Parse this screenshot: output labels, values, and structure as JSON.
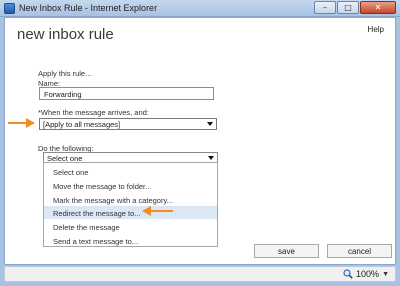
{
  "window": {
    "title": "New Inbox Rule - Internet Explorer",
    "minimize_icon": "minimize-icon",
    "maximize_icon": "maximize-icon",
    "close_icon": "close-icon",
    "minimize_glyph": "–",
    "maximize_glyph": "□",
    "close_glyph": "✕"
  },
  "page": {
    "heading": "new inbox rule",
    "help": "Help"
  },
  "form": {
    "apply_label": "Apply this rule...",
    "name_label": "Name:",
    "name_value": "Forwarding",
    "when_label": "*When the message arrives, and:",
    "when_value": "[Apply to all messages]",
    "do_label": "Do the following:",
    "do_value": "Select one"
  },
  "dropdown": {
    "options": [
      "Select one",
      "Move the message to folder...",
      "Mark the message with a category...",
      "Redirect the message to...",
      "Delete the message",
      "Send a text message to..."
    ],
    "highlighted_index": 3
  },
  "buttons": {
    "save": "save",
    "cancel": "cancel"
  },
  "statusbar": {
    "zoom": "100%",
    "zoom_icon": "zoom-magnifier-icon"
  },
  "colors": {
    "annotation_arrow": "#f28c28",
    "highlight_row": "#dbe7f4",
    "titlebar": "#a9c2e2"
  }
}
